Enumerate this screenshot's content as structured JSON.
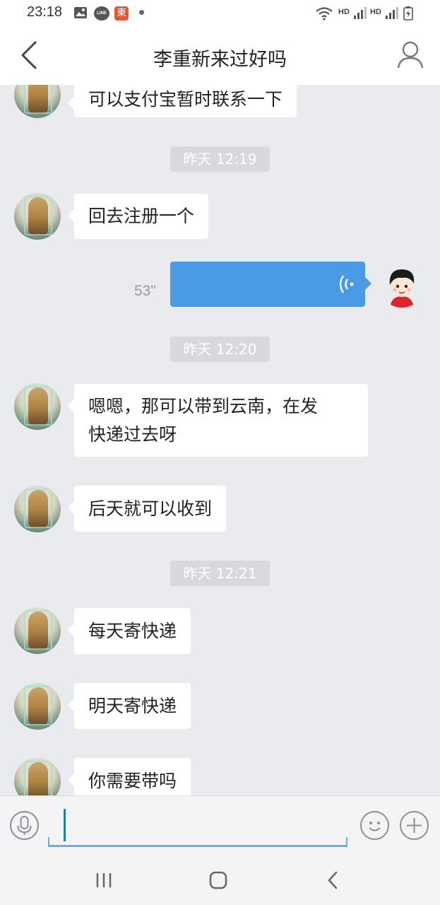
{
  "status_bar": {
    "time": "23:18",
    "icons": [
      "gallery-icon",
      "line-icon",
      "app-icon",
      "dot-icon"
    ],
    "right_icons": [
      "wifi-icon",
      "signal-icon",
      "battery-icon"
    ],
    "hd_label_1": "HD",
    "hd_label_2": "HD",
    "line_label": "LINE",
    "app_label": "東"
  },
  "header": {
    "title": "李重新来过好吗",
    "back_icon": "chevron-left-icon",
    "profile_icon": "person-icon"
  },
  "messages": [
    {
      "type": "received",
      "text": "可以支付宝暂时联系一下"
    },
    {
      "type": "time",
      "text": "昨天 12:19"
    },
    {
      "type": "received",
      "text": "回去注册一个"
    },
    {
      "type": "sent_voice",
      "duration": "53\""
    },
    {
      "type": "time",
      "text": "昨天 12:20"
    },
    {
      "type": "received",
      "lines": [
        "嗯嗯，那可以带到云南，在发",
        "快递过去呀"
      ]
    },
    {
      "type": "received",
      "text": "后天就可以收到"
    },
    {
      "type": "time",
      "text": "昨天 12:21"
    },
    {
      "type": "received",
      "text": "每天寄快递"
    },
    {
      "type": "received",
      "text": "明天寄快递"
    },
    {
      "type": "received",
      "text": "你需要带吗"
    }
  ],
  "input_bar": {
    "value": "",
    "icons": [
      "microphone-icon",
      "smiley-icon",
      "plus-icon"
    ]
  },
  "nav_bar": {
    "icons": [
      "recents-icon",
      "home-icon",
      "back-icon"
    ]
  },
  "colors": {
    "background": "#eaebee",
    "bubble_received": "#ffffff",
    "bubble_sent": "#4a9ae6",
    "time_chip": "#d8d9dc",
    "input_underline": "#6faed8"
  }
}
